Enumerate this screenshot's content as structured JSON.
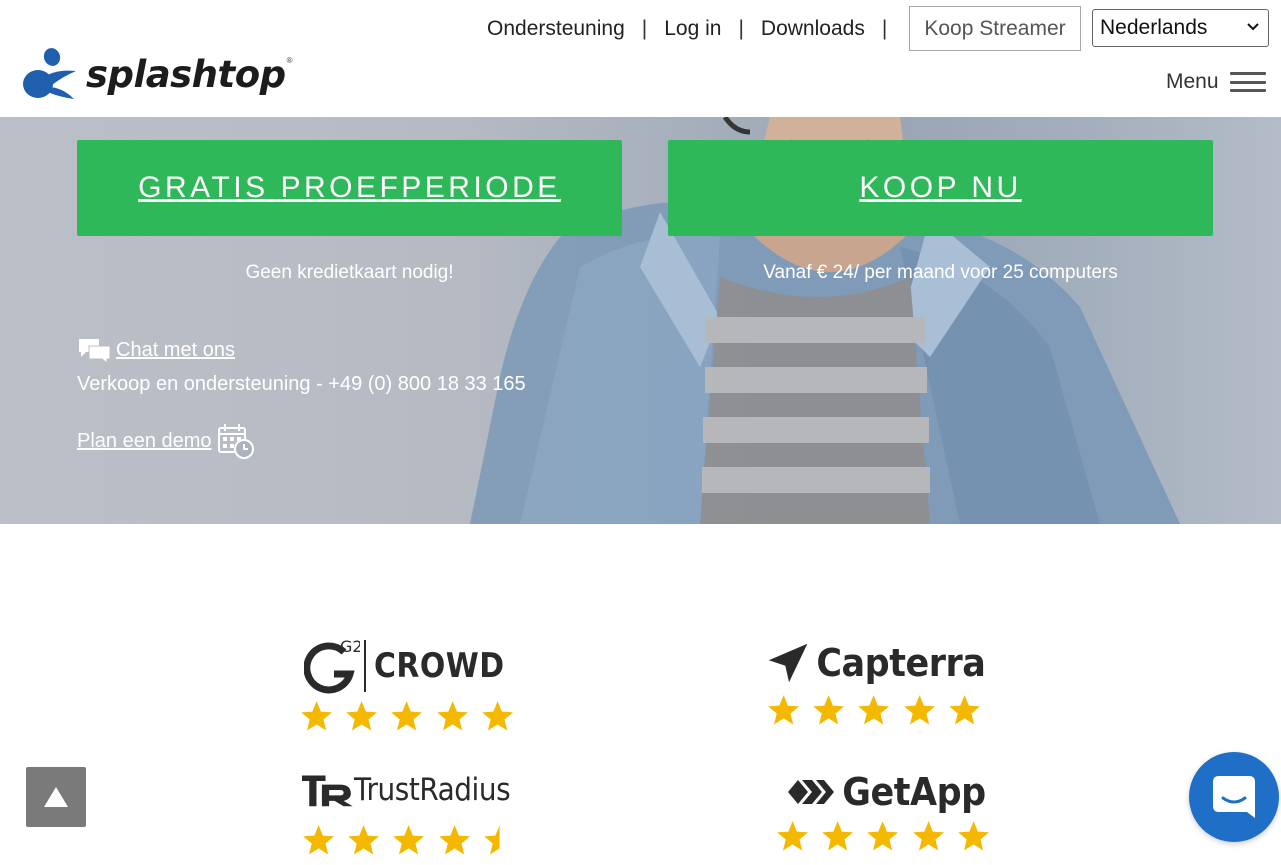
{
  "header": {
    "logo_text": "splashtop",
    "logo_reg": "®",
    "nav": [
      {
        "label": "Ondersteuning"
      },
      {
        "label": "Log in"
      },
      {
        "label": "Downloads"
      }
    ],
    "separator": "|",
    "buy_streamer_label": "Koop Streamer",
    "language_selected": "Nederlands",
    "menu_label": "Menu"
  },
  "hero": {
    "trial_button": "GRATIS PROEFPERIODE",
    "buy_button": "KOOP NU",
    "trial_note": "Geen kredietkaart nodig!",
    "buy_note": "Vanaf € 24/ per maand voor 25 computers",
    "chat_label": "Chat met ons",
    "phone_text": "Verkoop en ondersteuning - +49 (0) 800 18 33 165",
    "demo_label": "Plan een demo"
  },
  "reviews": [
    {
      "brand": "CROWD",
      "brand_prefix": "G2",
      "rating": 5
    },
    {
      "brand": "Capterra",
      "rating": 5
    },
    {
      "brand": "TrustRadius",
      "rating": 4.5
    },
    {
      "brand": "GetApp",
      "rating": 5
    }
  ],
  "colors": {
    "cta_green": "#2fb85a",
    "star_yellow": "#f5b800",
    "chat_blue": "#1f6fc7"
  }
}
